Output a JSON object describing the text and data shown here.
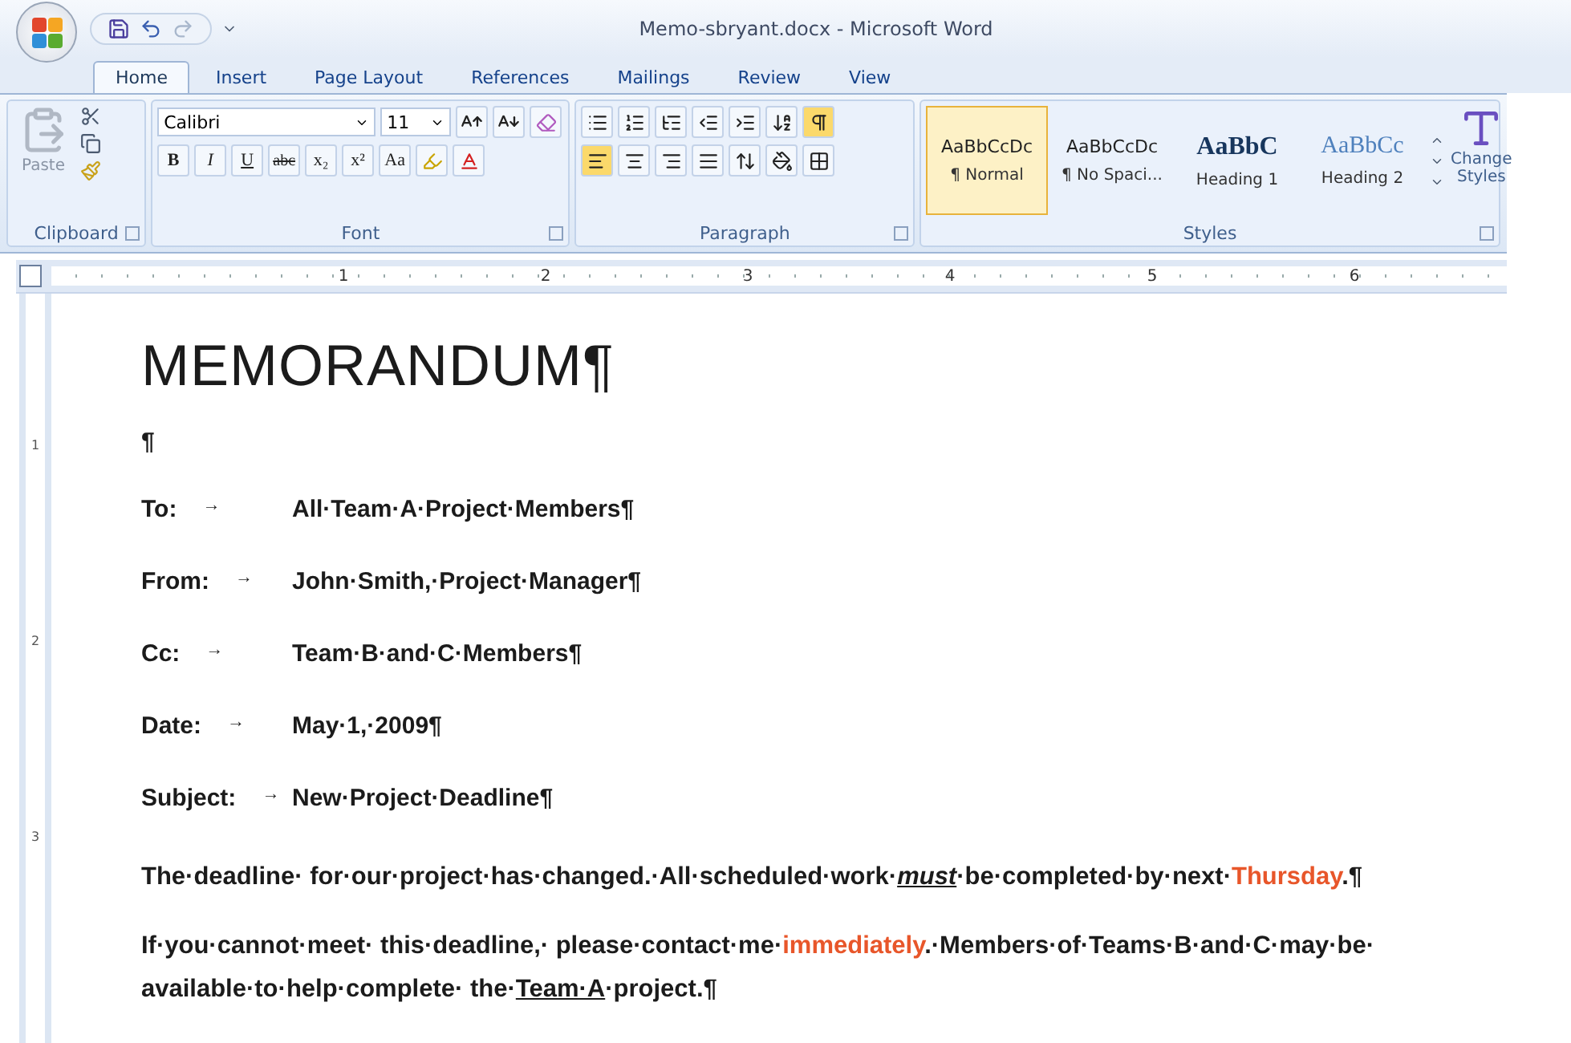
{
  "title": "Memo-sbryant.docx - Microsoft Word",
  "tabs": [
    {
      "label": "Home",
      "selected": true
    },
    {
      "label": "Insert",
      "selected": false
    },
    {
      "label": "Page Layout",
      "selected": false
    },
    {
      "label": "References",
      "selected": false
    },
    {
      "label": "Mailings",
      "selected": false
    },
    {
      "label": "Review",
      "selected": false
    },
    {
      "label": "View",
      "selected": false
    }
  ],
  "ribbon": {
    "clipboard": {
      "title": "Clipboard",
      "paste": "Paste"
    },
    "font": {
      "title": "Font",
      "name": "Calibri",
      "size": "11",
      "format_buttons": [
        {
          "kind": "bold",
          "text": "B"
        },
        {
          "kind": "italic",
          "text": "I"
        },
        {
          "kind": "underline",
          "text": "U"
        },
        {
          "kind": "strike",
          "text": "abc"
        },
        {
          "kind": "sub",
          "text": "x₂"
        },
        {
          "kind": "sup",
          "text": "x²"
        },
        {
          "kind": "case",
          "text": "Aa"
        }
      ]
    },
    "paragraph": {
      "title": "Paragraph",
      "align_buttons": [
        {
          "kind": "left",
          "selected": true
        },
        {
          "kind": "center",
          "selected": false
        },
        {
          "kind": "right",
          "selected": false
        },
        {
          "kind": "justify",
          "selected": false
        }
      ],
      "show_marks": true
    },
    "styles": {
      "title": "Styles",
      "items": [
        {
          "kind": "normal",
          "preview": "AaBbCcDc",
          "label": "¶ Normal",
          "selected": true
        },
        {
          "kind": "normal",
          "preview": "AaBbCcDc",
          "label": "¶ No Spaci...",
          "selected": false
        },
        {
          "kind": "heading1",
          "preview": "AaBbC",
          "label": "Heading 1",
          "selected": false
        },
        {
          "kind": "heading2",
          "preview": "AaBbCc",
          "label": "Heading 2",
          "selected": false
        }
      ],
      "change_styles": "Change Styles"
    }
  },
  "ruler": {
    "numbers": [
      "1",
      "2",
      "3",
      "4",
      "5",
      "6"
    ],
    "vertical_numbers": [
      "1",
      "2",
      "3"
    ]
  },
  "document": {
    "title": "MEMORANDUM¶",
    "blank": "¶",
    "headers": [
      {
        "label": "To:",
        "arrow": "→",
        "value": "All·Team·A·Project·Members¶"
      },
      {
        "label": "From:",
        "arrow": "→",
        "value": "John·Smith,·Project·Manager¶"
      },
      {
        "label": "Cc:",
        "arrow": "→",
        "value": "Team·B·and·C·Members¶"
      },
      {
        "label": "Date:",
        "arrow": "→",
        "value": "May·1,·2009¶"
      },
      {
        "label": "Subject:",
        "arrow": "→",
        "value": "New·Project·Deadline¶"
      }
    ],
    "paragraphs": [
      {
        "segments": [
          {
            "kind": "plain",
            "text": "The·deadline· for·our·project·has·changed.·All·scheduled·work·"
          },
          {
            "kind": "emphasis",
            "text": "must"
          },
          {
            "kind": "plain",
            "text": "·be·completed·by·next·"
          },
          {
            "kind": "highlight",
            "text": "Thursday"
          },
          {
            "kind": "plain",
            "text": ".¶"
          }
        ]
      },
      {
        "segments": [
          {
            "kind": "plain",
            "text": "If·you·cannot·meet· this·deadline,· please·contact·me·"
          },
          {
            "kind": "highlight",
            "text": "immediately"
          },
          {
            "kind": "plain",
            "text": ".·Members·of·Teams·B·and·C·may·be· available·to·help·complete· the·"
          },
          {
            "kind": "underline",
            "text": "Team·A"
          },
          {
            "kind": "plain",
            "text": "·project.¶"
          }
        ]
      }
    ]
  }
}
